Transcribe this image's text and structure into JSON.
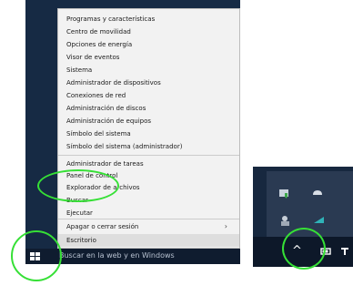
{
  "winx_menu": {
    "items": [
      "Programas y características",
      "Centro de movilidad",
      "Opciones de energía",
      "Visor de eventos",
      "Sistema",
      "Administrador de dispositivos",
      "Conexiones de red",
      "Administración de discos",
      "Administración de equipos",
      "Símbolo del sistema",
      "Símbolo del sistema (administrador)",
      "Administrador de tareas",
      "Panel de control",
      "Explorador de archivos",
      "Buscar",
      "Ejecutar",
      "Apagar o cerrar sesión",
      "Escritorio"
    ],
    "submenu_arrow": "›"
  },
  "taskbar": {
    "search_placeholder": "Buscar en la web y en Windows"
  },
  "tray": {
    "chevron": "^"
  },
  "colors": {
    "desktop": "#162a44",
    "menu_bg": "#f2f2f2",
    "taskbar": "#0f1c2f",
    "annotation": "#36e036"
  },
  "icons": [
    "windows-start-icon",
    "show-hidden-icons-chevron-icon",
    "security-shield-icon",
    "cloud-sync-icon",
    "people-icon",
    "network-icon",
    "battery-icon",
    "wifi-icon"
  ]
}
